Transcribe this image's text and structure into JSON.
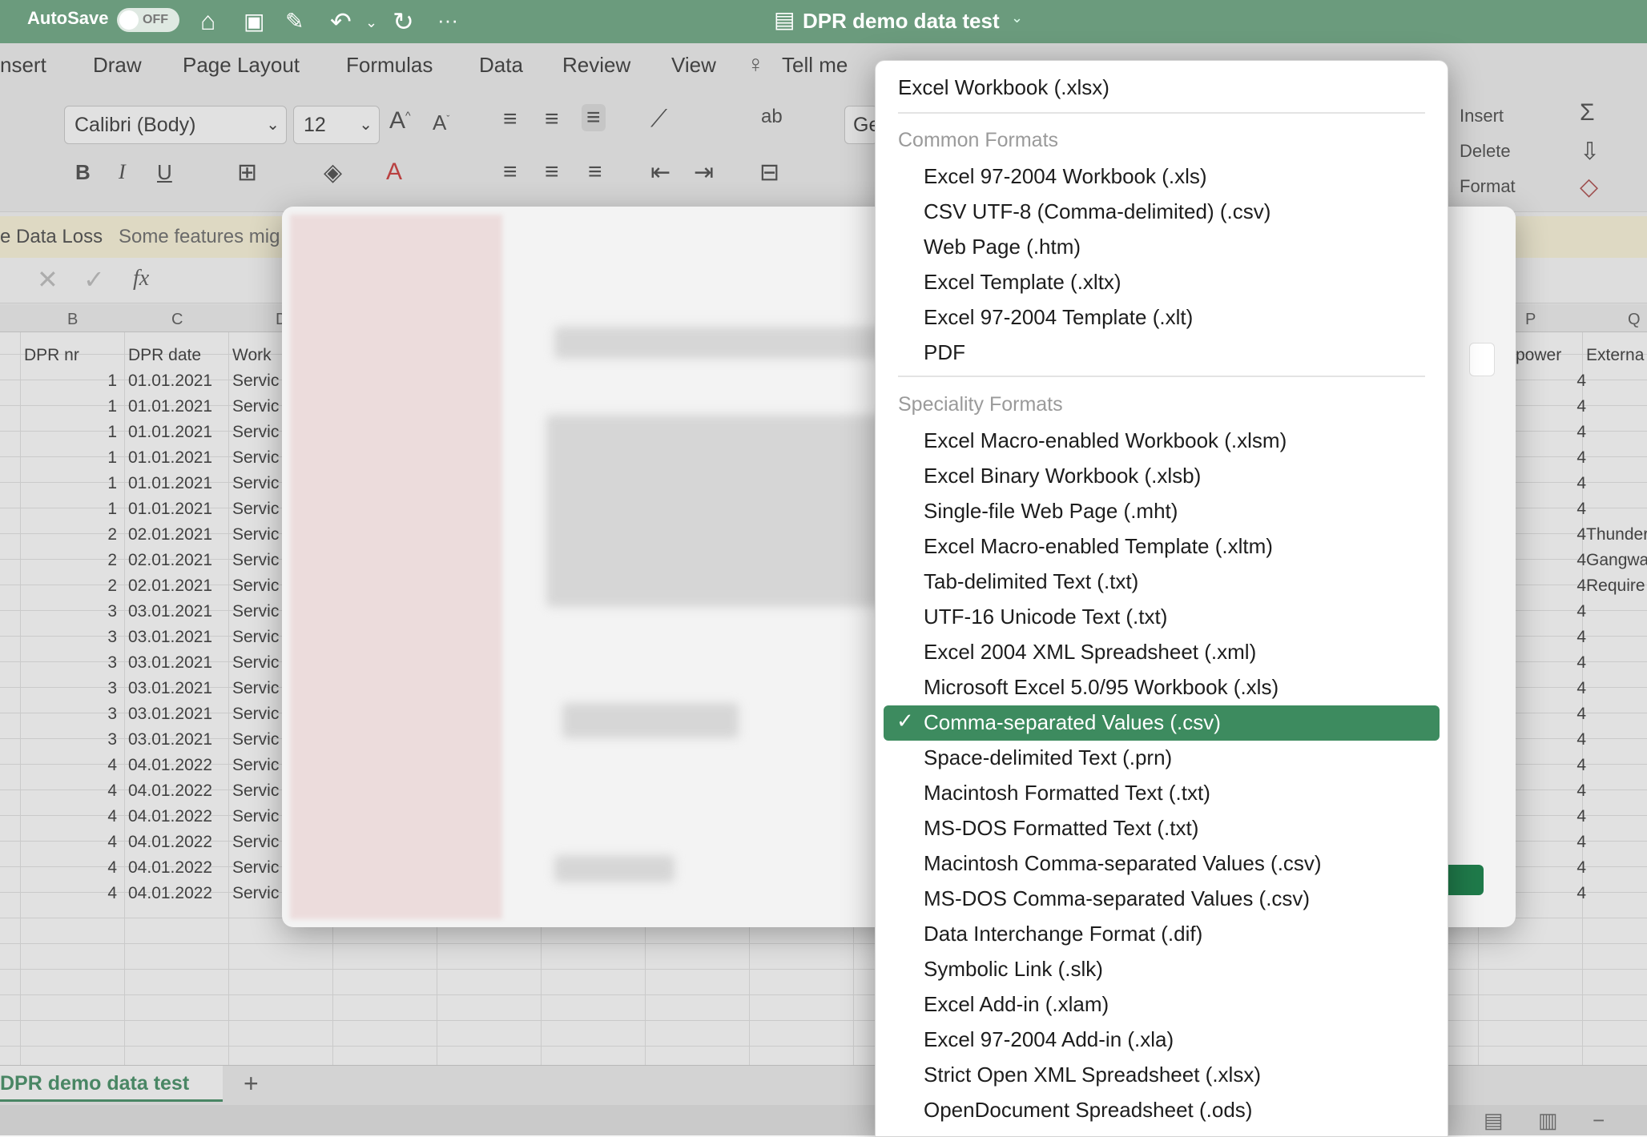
{
  "titlebar": {
    "autosave_label": "AutoSave",
    "autosave_state": "OFF",
    "doc_title": "DPR demo data test",
    "icons": [
      "home-icon",
      "save-icon",
      "save-as-icon",
      "undo-icon",
      "chevron-down-icon",
      "redo-icon",
      "more-icon"
    ]
  },
  "ribbon": {
    "tabs": [
      "nsert",
      "Draw",
      "Page Layout",
      "Formulas",
      "Data",
      "Review",
      "View",
      "Tell me"
    ],
    "font_name": "Calibri (Body)",
    "font_size": "12",
    "number_format": "Ge",
    "cells_group": {
      "insert": "Insert",
      "delete": "Delete",
      "format": "Format"
    }
  },
  "infobar": {
    "title": "e Data Loss",
    "message": "Some features mig"
  },
  "formula_bar": {
    "fx": "fx"
  },
  "grid": {
    "columns": [
      "B",
      "C",
      "D",
      "P",
      "Q"
    ],
    "headers": {
      "b": "DPR nr",
      "c": "DPR date",
      "d": "Work",
      "p": "power",
      "q": "Externa"
    },
    "rows": [
      {
        "b": "1",
        "c": "01.01.2021",
        "d": "Servic",
        "p": "4",
        "q": ""
      },
      {
        "b": "1",
        "c": "01.01.2021",
        "d": "Servic",
        "p": "4",
        "q": ""
      },
      {
        "b": "1",
        "c": "01.01.2021",
        "d": "Servic",
        "p": "4",
        "q": ""
      },
      {
        "b": "1",
        "c": "01.01.2021",
        "d": "Servic",
        "p": "4",
        "q": ""
      },
      {
        "b": "1",
        "c": "01.01.2021",
        "d": "Servic",
        "p": "4",
        "q": ""
      },
      {
        "b": "1",
        "c": "01.01.2021",
        "d": "Servic",
        "p": "4",
        "q": ""
      },
      {
        "b": "2",
        "c": "02.01.2021",
        "d": "Servic",
        "p": "4",
        "q": "Thunder"
      },
      {
        "b": "2",
        "c": "02.01.2021",
        "d": "Servic",
        "p": "4",
        "q": "Gangwa"
      },
      {
        "b": "2",
        "c": "02.01.2021",
        "d": "Servic",
        "p": "4",
        "q": "Require"
      },
      {
        "b": "3",
        "c": "03.01.2021",
        "d": "Servic",
        "p": "4",
        "q": ""
      },
      {
        "b": "3",
        "c": "03.01.2021",
        "d": "Servic",
        "p": "4",
        "q": ""
      },
      {
        "b": "3",
        "c": "03.01.2021",
        "d": "Servic",
        "p": "4",
        "q": ""
      },
      {
        "b": "3",
        "c": "03.01.2021",
        "d": "Servic",
        "p": "4",
        "q": ""
      },
      {
        "b": "3",
        "c": "03.01.2021",
        "d": "Servic",
        "p": "4",
        "q": ""
      },
      {
        "b": "3",
        "c": "03.01.2021",
        "d": "Servic",
        "p": "4",
        "q": ""
      },
      {
        "b": "4",
        "c": "04.01.2022",
        "d": "Servic",
        "p": "4",
        "q": ""
      },
      {
        "b": "4",
        "c": "04.01.2022",
        "d": "Servic",
        "p": "4",
        "q": ""
      },
      {
        "b": "4",
        "c": "04.01.2022",
        "d": "Servic",
        "p": "4",
        "q": ""
      },
      {
        "b": "4",
        "c": "04.01.2022",
        "d": "Servic",
        "p": "4",
        "q": ""
      },
      {
        "b": "4",
        "c": "04.01.2022",
        "d": "Servic",
        "p": "4",
        "q": ""
      },
      {
        "b": "4",
        "c": "04.01.2022",
        "d": "Servic",
        "p": "4",
        "q": ""
      }
    ]
  },
  "sheet_tabs": {
    "active": "DPR demo data test",
    "add": "+"
  },
  "format_menu": {
    "top_item": "Excel Workbook (.xlsx)",
    "common_header": "Common Formats",
    "common": [
      "Excel 97-2004 Workbook (.xls)",
      "CSV UTF-8 (Comma-delimited) (.csv)",
      "Web Page (.htm)",
      "Excel Template (.xltx)",
      "Excel 97-2004 Template (.xlt)",
      "PDF"
    ],
    "speciality_header": "Speciality Formats",
    "speciality": [
      "Excel Macro-enabled Workbook (.xlsm)",
      "Excel Binary Workbook (.xlsb)",
      "Single-file Web Page (.mht)",
      "Excel Macro-enabled Template (.xltm)",
      "Tab-delimited Text (.txt)",
      "UTF-16 Unicode Text (.txt)",
      "Excel 2004 XML Spreadsheet (.xml)",
      "Microsoft Excel 5.0/95 Workbook (.xls)",
      "Comma-separated Values (.csv)",
      "Space-delimited Text (.prn)",
      "Macintosh Formatted Text (.txt)",
      "MS-DOS Formatted Text (.txt)",
      "Macintosh Comma-separated Values (.csv)",
      "MS-DOS Comma-separated Values (.csv)",
      "Data Interchange Format (.dif)",
      "Symbolic Link (.slk)",
      "Excel Add-in (.xlam)",
      "Excel 97-2004 Add-in (.xla)",
      "Strict Open XML Spreadsheet (.xlsx)",
      "OpenDocument Spreadsheet (.ods)"
    ],
    "selected": "Comma-separated Values (.csv)",
    "check": "✓"
  }
}
